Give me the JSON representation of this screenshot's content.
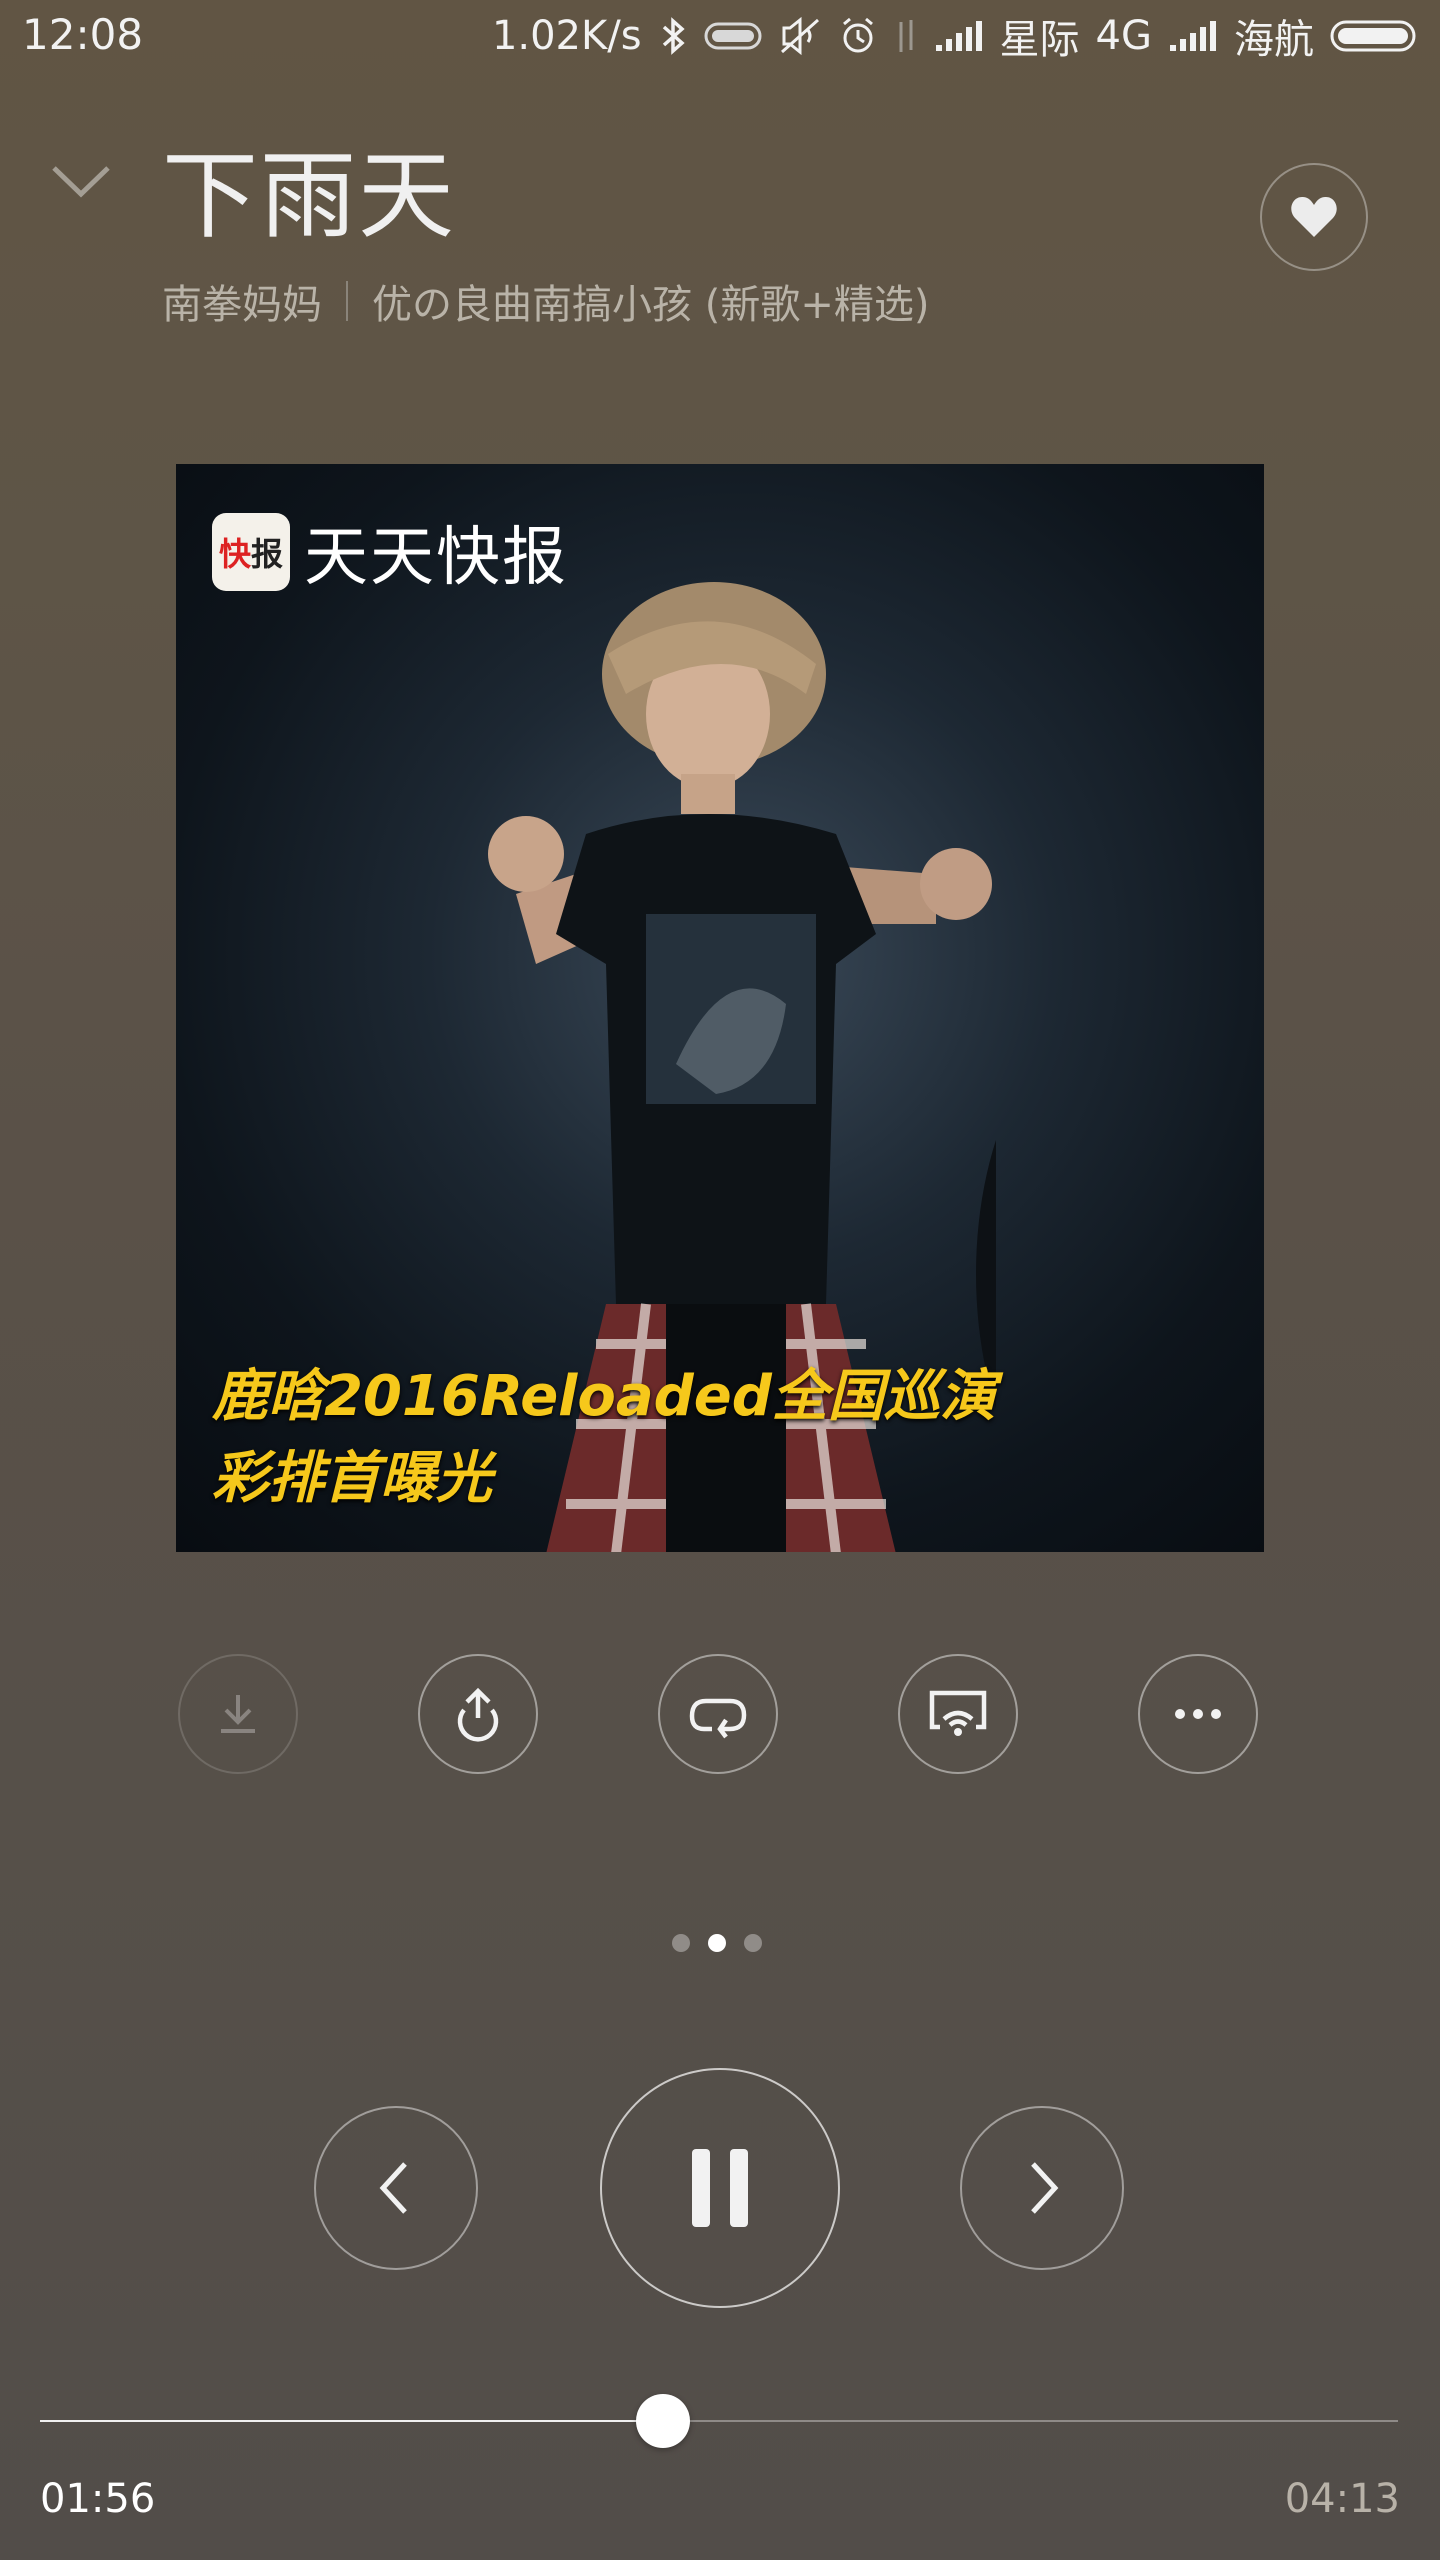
{
  "status_bar": {
    "time": "12:08",
    "net_speed": "1.02K/s",
    "carrier1": "星际",
    "network": "4G",
    "carrier2": "海航",
    "icons": [
      "bluetooth-icon",
      "battery-saver-icon",
      "mute-icon",
      "alarm-icon",
      "data-arrows-icon",
      "signal-icon",
      "signal-icon",
      "battery-icon"
    ]
  },
  "song": {
    "title": "下雨天",
    "artist": "南拳妈妈",
    "album": "优の良曲南搞小孩 (新歌+精选)"
  },
  "cover": {
    "logo_mark_1": "快",
    "logo_mark_2": "报",
    "logo_text": "天天快报",
    "caption_line1": "鹿晗2016Reloaded全国巡演",
    "caption_line2": "彩排首曝光"
  },
  "actions": [
    {
      "name": "download-button",
      "icon": "download-icon",
      "enabled": false
    },
    {
      "name": "share-button",
      "icon": "share-icon",
      "enabled": true
    },
    {
      "name": "repeat-button",
      "icon": "repeat-icon",
      "enabled": true
    },
    {
      "name": "cast-button",
      "icon": "cast-icon",
      "enabled": true
    },
    {
      "name": "more-button",
      "icon": "more-icon",
      "enabled": true
    }
  ],
  "pager": {
    "count": 3,
    "active_index": 1
  },
  "playback": {
    "state": "playing",
    "current_time": "01:56",
    "total_time": "04:13",
    "progress": 0.459
  },
  "colors": {
    "caption": "#f6c81b",
    "background_top": "#615544",
    "background_bottom": "#524d49"
  }
}
